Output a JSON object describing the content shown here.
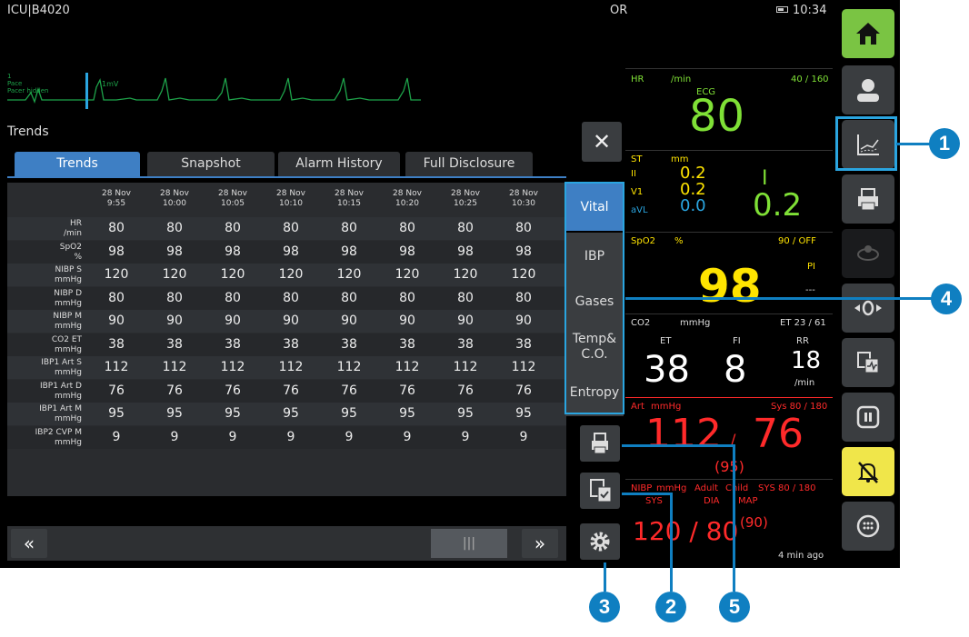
{
  "topbar": {
    "bed": "ICU|B4020",
    "location": "OR",
    "time": "10:34"
  },
  "ecg": {
    "lead_label": "1\nPace\nPacer hidden",
    "unit": "1mV"
  },
  "trends": {
    "title": "Trends",
    "tabs": [
      "Trends",
      "Snapshot",
      "Alarm History",
      "Full Disclosure"
    ],
    "times": [
      [
        "28 Nov",
        "9:55"
      ],
      [
        "28 Nov",
        "10:00"
      ],
      [
        "28 Nov",
        "10:05"
      ],
      [
        "28 Nov",
        "10:10"
      ],
      [
        "28 Nov",
        "10:15"
      ],
      [
        "28 Nov",
        "10:20"
      ],
      [
        "28 Nov",
        "10:25"
      ],
      [
        "28 Nov",
        "10:30"
      ]
    ],
    "rows": [
      {
        "p": "HR",
        "u": "/min",
        "v": [
          "80",
          "80",
          "80",
          "80",
          "80",
          "80",
          "80",
          "80"
        ]
      },
      {
        "p": "SpO2",
        "u": "%",
        "v": [
          "98",
          "98",
          "98",
          "98",
          "98",
          "98",
          "98",
          "98"
        ]
      },
      {
        "p": "NIBP S",
        "u": "mmHg",
        "v": [
          "120",
          "120",
          "120",
          "120",
          "120",
          "120",
          "120",
          "120"
        ]
      },
      {
        "p": "NIBP D",
        "u": "mmHg",
        "v": [
          "80",
          "80",
          "80",
          "80",
          "80",
          "80",
          "80",
          "80"
        ]
      },
      {
        "p": "NIBP M",
        "u": "mmHg",
        "v": [
          "90",
          "90",
          "90",
          "90",
          "90",
          "90",
          "90",
          "90"
        ]
      },
      {
        "p": "CO2 ET",
        "u": "mmHg",
        "v": [
          "38",
          "38",
          "38",
          "38",
          "38",
          "38",
          "38",
          "38"
        ]
      },
      {
        "p": "IBP1 Art S",
        "u": "mmHg",
        "v": [
          "112",
          "112",
          "112",
          "112",
          "112",
          "112",
          "112",
          "112"
        ]
      },
      {
        "p": "IBP1 Art D",
        "u": "mmHg",
        "v": [
          "76",
          "76",
          "76",
          "76",
          "76",
          "76",
          "76",
          "76"
        ]
      },
      {
        "p": "IBP1 Art M",
        "u": "mmHg",
        "v": [
          "95",
          "95",
          "95",
          "95",
          "95",
          "95",
          "95",
          "95"
        ]
      },
      {
        "p": "IBP2 CVP M",
        "u": "mmHg",
        "v": [
          "9",
          "9",
          "9",
          "9",
          "9",
          "9",
          "9",
          "9"
        ]
      }
    ],
    "categories": [
      "Vital",
      "IBP",
      "Gases",
      "Temp& C.O.",
      "Entropy"
    ],
    "scroll_thumb": "|||"
  },
  "vitals": {
    "hr": {
      "label": "HR",
      "unit": "/min",
      "limits": "40 / 160",
      "source": "ECG",
      "value": "80",
      "color": "#7fe036"
    },
    "st": {
      "label": "ST",
      "unit": "mm",
      "leads": [
        "II",
        "V1",
        "aVL"
      ],
      "values": [
        "0.2",
        "0.2",
        "0.0"
      ],
      "big_lead": "I",
      "big_value": "0.2"
    },
    "spo2": {
      "label": "SpO2",
      "unit": "%",
      "limits": "90 / OFF",
      "pi": "PI",
      "pi_value": "---",
      "value": "98",
      "color": "#ffe400"
    },
    "co2": {
      "label": "CO2",
      "unit": "mmHg",
      "limits": "ET 23 / 61",
      "et_label": "ET",
      "fi_label": "FI",
      "rr_label": "RR",
      "et": "38",
      "fi": "8",
      "rr": "18",
      "rr_unit": "/min"
    },
    "art": {
      "label": "Art",
      "unit": "mmHg",
      "limits": "Sys 80 / 180",
      "sys": "112",
      "sep": "/",
      "dia": "76",
      "mean": "(95)",
      "color": "#ff2a2a"
    },
    "nibp": {
      "label": "NIBP",
      "unit": "mmHg",
      "mode": "Adult",
      "child": "Child",
      "limits": "SYS 80 / 180",
      "sys_label": "SYS",
      "dia_label": "DIA",
      "map_label": "MAP",
      "value": "120 / 80",
      "map": "(90)",
      "ago": "4 min ago"
    }
  },
  "callouts": [
    "1",
    "2",
    "3",
    "4",
    "5"
  ]
}
